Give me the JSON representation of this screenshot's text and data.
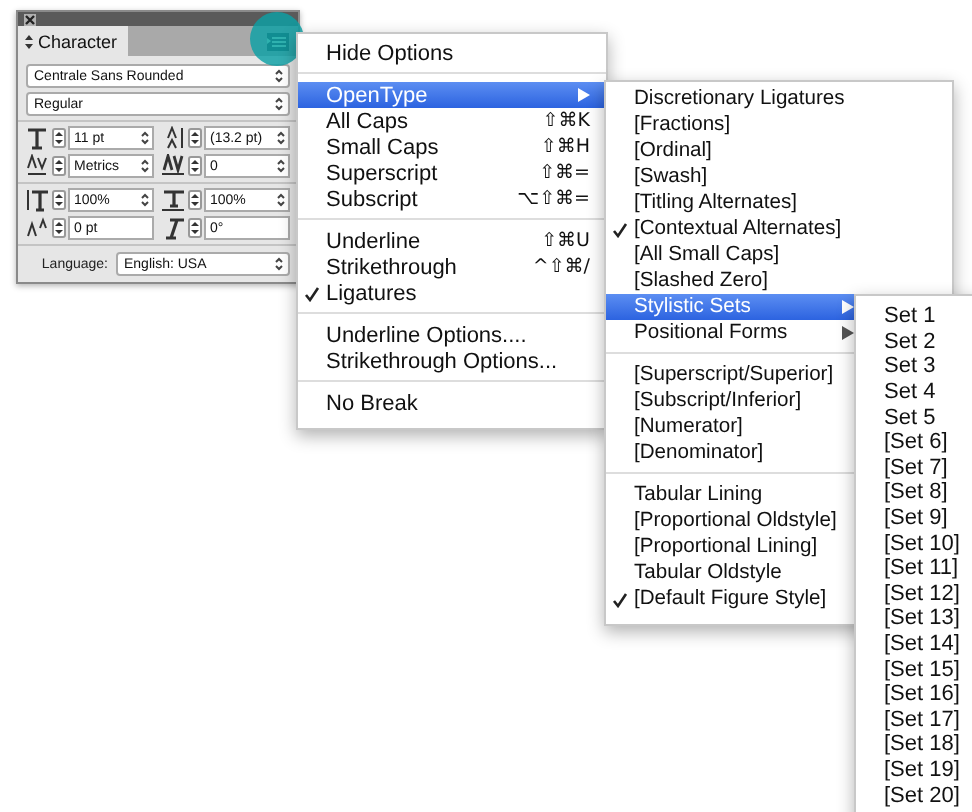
{
  "panel": {
    "title": "Character",
    "font_family": "Centrale Sans Rounded",
    "font_style": "Regular",
    "field_rows": [
      [
        {
          "kind": "size",
          "value": "11 pt",
          "dropdown": true
        },
        {
          "kind": "leading",
          "value": "(13.2 pt)",
          "dropdown": true
        }
      ],
      [
        {
          "kind": "kerning",
          "value": "Metrics",
          "dropdown": true
        },
        {
          "kind": "tracking",
          "value": "0",
          "dropdown": true
        }
      ],
      [
        {
          "kind": "vertical-scale",
          "value": "100%",
          "dropdown": true
        },
        {
          "kind": "horizontal-scale",
          "value": "100%",
          "dropdown": true
        }
      ],
      [
        {
          "kind": "baseline",
          "value": "0 pt",
          "dropdown": false
        },
        {
          "kind": "skew",
          "value": "0°",
          "dropdown": false
        }
      ]
    ],
    "language_label": "Language:",
    "language": "English: USA"
  },
  "menus": [
    {
      "items": [
        {
          "kind": "item",
          "label": "Hide Options",
          "checked": false,
          "selected": false,
          "submenu": false
        },
        {
          "kind": "separator"
        },
        {
          "kind": "item",
          "label": "OpenType",
          "checked": false,
          "selected": true,
          "submenu": true
        },
        {
          "kind": "item",
          "label": "All Caps",
          "shortcut": "⇧⌘K",
          "checked": false,
          "selected": false,
          "submenu": false
        },
        {
          "kind": "item",
          "label": "Small Caps",
          "shortcut": "⇧⌘H",
          "checked": false,
          "selected": false,
          "submenu": false
        },
        {
          "kind": "item",
          "label": "Superscript",
          "shortcut": "⇧⌘=",
          "checked": false,
          "selected": false,
          "submenu": false
        },
        {
          "kind": "item",
          "label": "Subscript",
          "shortcut": "⌥⇧⌘=",
          "checked": false,
          "selected": false,
          "submenu": false
        },
        {
          "kind": "separator"
        },
        {
          "kind": "item",
          "label": "Underline",
          "shortcut": "⇧⌘U",
          "checked": false,
          "selected": false,
          "submenu": false
        },
        {
          "kind": "item",
          "label": "Strikethrough",
          "shortcut": "^⇧⌘/",
          "checked": false,
          "selected": false,
          "submenu": false
        },
        {
          "kind": "item",
          "label": "Ligatures",
          "checked": true,
          "selected": false,
          "submenu": false
        },
        {
          "kind": "separator"
        },
        {
          "kind": "item",
          "label": "Underline Options....",
          "checked": false,
          "selected": false,
          "submenu": false
        },
        {
          "kind": "item",
          "label": "Strikethrough Options...",
          "checked": false,
          "selected": false,
          "submenu": false
        },
        {
          "kind": "separator"
        },
        {
          "kind": "item",
          "label": "No Break",
          "checked": false,
          "selected": false,
          "submenu": false
        }
      ]
    },
    {
      "items": [
        {
          "kind": "item",
          "label": "Discretionary Ligatures",
          "checked": false,
          "selected": false,
          "submenu": false
        },
        {
          "kind": "item",
          "label": "[Fractions]",
          "checked": false,
          "selected": false,
          "submenu": false
        },
        {
          "kind": "item",
          "label": "[Ordinal]",
          "checked": false,
          "selected": false,
          "submenu": false
        },
        {
          "kind": "item",
          "label": "[Swash]",
          "checked": false,
          "selected": false,
          "submenu": false
        },
        {
          "kind": "item",
          "label": "[Titling Alternates]",
          "checked": false,
          "selected": false,
          "submenu": false
        },
        {
          "kind": "item",
          "label": "[Contextual Alternates]",
          "checked": true,
          "selected": false,
          "submenu": false
        },
        {
          "kind": "item",
          "label": "[All Small Caps]",
          "checked": false,
          "selected": false,
          "submenu": false
        },
        {
          "kind": "item",
          "label": "[Slashed Zero]",
          "checked": false,
          "selected": false,
          "submenu": false
        },
        {
          "kind": "item",
          "label": "Stylistic Sets",
          "checked": false,
          "selected": true,
          "submenu": true
        },
        {
          "kind": "item",
          "label": "Positional Forms",
          "checked": false,
          "selected": false,
          "submenu": true
        },
        {
          "kind": "separator"
        },
        {
          "kind": "item",
          "label": "[Superscript/Superior]",
          "checked": false,
          "selected": false,
          "submenu": false
        },
        {
          "kind": "item",
          "label": "[Subscript/Inferior]",
          "checked": false,
          "selected": false,
          "submenu": false
        },
        {
          "kind": "item",
          "label": "[Numerator]",
          "checked": false,
          "selected": false,
          "submenu": false
        },
        {
          "kind": "item",
          "label": "[Denominator]",
          "checked": false,
          "selected": false,
          "submenu": false
        },
        {
          "kind": "separator"
        },
        {
          "kind": "item",
          "label": "Tabular Lining",
          "checked": false,
          "selected": false,
          "submenu": false
        },
        {
          "kind": "item",
          "label": "[Proportional Oldstyle]",
          "checked": false,
          "selected": false,
          "submenu": false
        },
        {
          "kind": "item",
          "label": "[Proportional Lining]",
          "checked": false,
          "selected": false,
          "submenu": false
        },
        {
          "kind": "item",
          "label": "Tabular Oldstyle",
          "checked": false,
          "selected": false,
          "submenu": false
        },
        {
          "kind": "item",
          "label": "[Default Figure Style]",
          "checked": true,
          "selected": false,
          "submenu": false
        }
      ]
    },
    {
      "items": [
        {
          "kind": "item",
          "label": "Set 1",
          "checked": false,
          "selected": false,
          "submenu": false
        },
        {
          "kind": "item",
          "label": "Set 2",
          "checked": false,
          "selected": false,
          "submenu": false
        },
        {
          "kind": "item",
          "label": "Set 3",
          "checked": false,
          "selected": false,
          "submenu": false
        },
        {
          "kind": "item",
          "label": "Set 4",
          "checked": false,
          "selected": false,
          "submenu": false
        },
        {
          "kind": "item",
          "label": "Set 5",
          "checked": false,
          "selected": false,
          "submenu": false
        },
        {
          "kind": "item",
          "label": "[Set 6]",
          "checked": false,
          "selected": false,
          "submenu": false
        },
        {
          "kind": "item",
          "label": "[Set 7]",
          "checked": false,
          "selected": false,
          "submenu": false
        },
        {
          "kind": "item",
          "label": "[Set 8]",
          "checked": false,
          "selected": false,
          "submenu": false
        },
        {
          "kind": "item",
          "label": "[Set 9]",
          "checked": false,
          "selected": false,
          "submenu": false
        },
        {
          "kind": "item",
          "label": "[Set 10]",
          "checked": false,
          "selected": false,
          "submenu": false
        },
        {
          "kind": "item",
          "label": "[Set 11]",
          "checked": false,
          "selected": false,
          "submenu": false
        },
        {
          "kind": "item",
          "label": "[Set 12]",
          "checked": false,
          "selected": false,
          "submenu": false
        },
        {
          "kind": "item",
          "label": "[Set 13]",
          "checked": false,
          "selected": false,
          "submenu": false
        },
        {
          "kind": "item",
          "label": "[Set 14]",
          "checked": false,
          "selected": false,
          "submenu": false
        },
        {
          "kind": "item",
          "label": "[Set 15]",
          "checked": false,
          "selected": false,
          "submenu": false
        },
        {
          "kind": "item",
          "label": "[Set 16]",
          "checked": false,
          "selected": false,
          "submenu": false
        },
        {
          "kind": "item",
          "label": "[Set 17]",
          "checked": false,
          "selected": false,
          "submenu": false
        },
        {
          "kind": "item",
          "label": "[Set 18]",
          "checked": false,
          "selected": false,
          "submenu": false
        },
        {
          "kind": "item",
          "label": "[Set 19]",
          "checked": false,
          "selected": false,
          "submenu": false
        },
        {
          "kind": "item",
          "label": "[Set 20]",
          "checked": false,
          "selected": false,
          "submenu": false
        }
      ]
    }
  ]
}
